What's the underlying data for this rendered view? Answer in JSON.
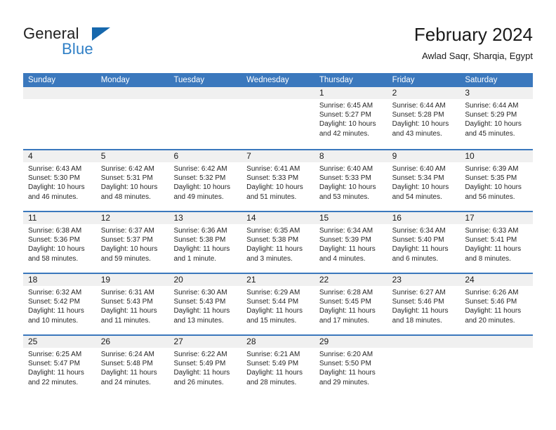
{
  "logo": {
    "word_one": "General",
    "word_two": "Blue",
    "triangle_icon": "triangle-icon"
  },
  "header": {
    "title": "February 2024",
    "subtitle": "Awlad Saqr, Sharqia, Egypt"
  },
  "colors": {
    "header_blue": "#3B78BD",
    "logo_blue": "#2F7FC6",
    "triangle_blue": "#1668AD",
    "day_band_gray": "#F0F0F0",
    "text": "#1A1A1A"
  },
  "weekdays": [
    "Sunday",
    "Monday",
    "Tuesday",
    "Wednesday",
    "Thursday",
    "Friday",
    "Saturday"
  ],
  "weeks": [
    [
      {
        "day": "",
        "lines": []
      },
      {
        "day": "",
        "lines": []
      },
      {
        "day": "",
        "lines": []
      },
      {
        "day": "",
        "lines": []
      },
      {
        "day": "1",
        "lines": [
          "Sunrise: 6:45 AM",
          "Sunset: 5:27 PM",
          "Daylight: 10 hours",
          "and 42 minutes."
        ]
      },
      {
        "day": "2",
        "lines": [
          "Sunrise: 6:44 AM",
          "Sunset: 5:28 PM",
          "Daylight: 10 hours",
          "and 43 minutes."
        ]
      },
      {
        "day": "3",
        "lines": [
          "Sunrise: 6:44 AM",
          "Sunset: 5:29 PM",
          "Daylight: 10 hours",
          "and 45 minutes."
        ]
      }
    ],
    [
      {
        "day": "4",
        "lines": [
          "Sunrise: 6:43 AM",
          "Sunset: 5:30 PM",
          "Daylight: 10 hours",
          "and 46 minutes."
        ]
      },
      {
        "day": "5",
        "lines": [
          "Sunrise: 6:42 AM",
          "Sunset: 5:31 PM",
          "Daylight: 10 hours",
          "and 48 minutes."
        ]
      },
      {
        "day": "6",
        "lines": [
          "Sunrise: 6:42 AM",
          "Sunset: 5:32 PM",
          "Daylight: 10 hours",
          "and 49 minutes."
        ]
      },
      {
        "day": "7",
        "lines": [
          "Sunrise: 6:41 AM",
          "Sunset: 5:33 PM",
          "Daylight: 10 hours",
          "and 51 minutes."
        ]
      },
      {
        "day": "8",
        "lines": [
          "Sunrise: 6:40 AM",
          "Sunset: 5:33 PM",
          "Daylight: 10 hours",
          "and 53 minutes."
        ]
      },
      {
        "day": "9",
        "lines": [
          "Sunrise: 6:40 AM",
          "Sunset: 5:34 PM",
          "Daylight: 10 hours",
          "and 54 minutes."
        ]
      },
      {
        "day": "10",
        "lines": [
          "Sunrise: 6:39 AM",
          "Sunset: 5:35 PM",
          "Daylight: 10 hours",
          "and 56 minutes."
        ]
      }
    ],
    [
      {
        "day": "11",
        "lines": [
          "Sunrise: 6:38 AM",
          "Sunset: 5:36 PM",
          "Daylight: 10 hours",
          "and 58 minutes."
        ]
      },
      {
        "day": "12",
        "lines": [
          "Sunrise: 6:37 AM",
          "Sunset: 5:37 PM",
          "Daylight: 10 hours",
          "and 59 minutes."
        ]
      },
      {
        "day": "13",
        "lines": [
          "Sunrise: 6:36 AM",
          "Sunset: 5:38 PM",
          "Daylight: 11 hours",
          "and 1 minute."
        ]
      },
      {
        "day": "14",
        "lines": [
          "Sunrise: 6:35 AM",
          "Sunset: 5:38 PM",
          "Daylight: 11 hours",
          "and 3 minutes."
        ]
      },
      {
        "day": "15",
        "lines": [
          "Sunrise: 6:34 AM",
          "Sunset: 5:39 PM",
          "Daylight: 11 hours",
          "and 4 minutes."
        ]
      },
      {
        "day": "16",
        "lines": [
          "Sunrise: 6:34 AM",
          "Sunset: 5:40 PM",
          "Daylight: 11 hours",
          "and 6 minutes."
        ]
      },
      {
        "day": "17",
        "lines": [
          "Sunrise: 6:33 AM",
          "Sunset: 5:41 PM",
          "Daylight: 11 hours",
          "and 8 minutes."
        ]
      }
    ],
    [
      {
        "day": "18",
        "lines": [
          "Sunrise: 6:32 AM",
          "Sunset: 5:42 PM",
          "Daylight: 11 hours",
          "and 10 minutes."
        ]
      },
      {
        "day": "19",
        "lines": [
          "Sunrise: 6:31 AM",
          "Sunset: 5:43 PM",
          "Daylight: 11 hours",
          "and 11 minutes."
        ]
      },
      {
        "day": "20",
        "lines": [
          "Sunrise: 6:30 AM",
          "Sunset: 5:43 PM",
          "Daylight: 11 hours",
          "and 13 minutes."
        ]
      },
      {
        "day": "21",
        "lines": [
          "Sunrise: 6:29 AM",
          "Sunset: 5:44 PM",
          "Daylight: 11 hours",
          "and 15 minutes."
        ]
      },
      {
        "day": "22",
        "lines": [
          "Sunrise: 6:28 AM",
          "Sunset: 5:45 PM",
          "Daylight: 11 hours",
          "and 17 minutes."
        ]
      },
      {
        "day": "23",
        "lines": [
          "Sunrise: 6:27 AM",
          "Sunset: 5:46 PM",
          "Daylight: 11 hours",
          "and 18 minutes."
        ]
      },
      {
        "day": "24",
        "lines": [
          "Sunrise: 6:26 AM",
          "Sunset: 5:46 PM",
          "Daylight: 11 hours",
          "and 20 minutes."
        ]
      }
    ],
    [
      {
        "day": "25",
        "lines": [
          "Sunrise: 6:25 AM",
          "Sunset: 5:47 PM",
          "Daylight: 11 hours",
          "and 22 minutes."
        ]
      },
      {
        "day": "26",
        "lines": [
          "Sunrise: 6:24 AM",
          "Sunset: 5:48 PM",
          "Daylight: 11 hours",
          "and 24 minutes."
        ]
      },
      {
        "day": "27",
        "lines": [
          "Sunrise: 6:22 AM",
          "Sunset: 5:49 PM",
          "Daylight: 11 hours",
          "and 26 minutes."
        ]
      },
      {
        "day": "28",
        "lines": [
          "Sunrise: 6:21 AM",
          "Sunset: 5:49 PM",
          "Daylight: 11 hours",
          "and 28 minutes."
        ]
      },
      {
        "day": "29",
        "lines": [
          "Sunrise: 6:20 AM",
          "Sunset: 5:50 PM",
          "Daylight: 11 hours",
          "and 29 minutes."
        ]
      },
      {
        "day": "",
        "lines": []
      },
      {
        "day": "",
        "lines": []
      }
    ]
  ]
}
